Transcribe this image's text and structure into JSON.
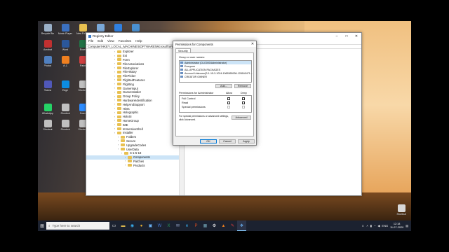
{
  "desktop": {
    "icons": [
      {
        "label": "Recycle Bin",
        "color": "#9ab0c8"
      },
      {
        "label": "Music Player",
        "color": "#3b70c0"
      },
      {
        "label": "New Folder",
        "color": "#e8c050"
      },
      {
        "label": "Notepad",
        "color": "#7aa8d8"
      },
      {
        "label": "Files",
        "color": "#3080e0"
      },
      {
        "label": "This PC",
        "color": "#4a90d0"
      },
      {
        "label": "Acrobat",
        "color": "#c03030"
      },
      {
        "label": "Word",
        "color": "#2b579a"
      },
      {
        "label": "Excel",
        "color": "#217346"
      },
      {
        "label": "Steam",
        "color": "#1b2838"
      },
      {
        "label": "Chrome",
        "color": "#e8b030"
      },
      {
        "label": "Firefox",
        "color": "#e86020"
      },
      {
        "label": "Photos",
        "color": "#5080c0"
      },
      {
        "label": "VLC",
        "color": "#f08020"
      },
      {
        "label": "Paint",
        "color": "#d04040"
      },
      {
        "label": "Opera",
        "color": "#d02030"
      },
      {
        "label": "Spotify",
        "color": "#1db954"
      },
      {
        "label": "Skype",
        "color": "#00aff0"
      },
      {
        "label": "Teams",
        "color": "#5058b8"
      },
      {
        "label": "Edge",
        "color": "#0c8ce0"
      },
      {
        "label": "Shortcut",
        "color": "#c0c0c0"
      },
      {
        "label": "Shortcut",
        "color": "#c0c0c0"
      },
      {
        "label": "Shortcut",
        "color": "#c0c0c0"
      },
      {
        "label": "Shortcut",
        "color": "#c0c0c0"
      },
      {
        "label": "WhatsApp",
        "color": "#25d366"
      },
      {
        "label": "Shortcut",
        "color": "#c0c0c0"
      },
      {
        "label": "Zoom",
        "color": "#2d8cff"
      },
      {
        "label": "Shortcut",
        "color": "#c0c0c0"
      },
      {
        "label": "Shortcut",
        "color": "#c0c0c0"
      },
      {
        "label": "OBS Studio",
        "color": "#302e31"
      },
      {
        "label": "Shortcut",
        "color": "#c0c0c0"
      },
      {
        "label": "Shortcut",
        "color": "#c0c0c0"
      },
      {
        "label": "Shortcut",
        "color": "#c0c0c0"
      },
      {
        "label": "Shortcut",
        "color": "#c0c0c0"
      },
      {
        "label": "Shortcut",
        "color": "#c0c0c0"
      },
      {
        "label": "Shortcut",
        "color": "#c0c0c0"
      }
    ],
    "right_icon": {
      "label": "Shortcut"
    }
  },
  "regedit": {
    "title": "Registry Editor",
    "menu": [
      "File",
      "Edit",
      "View",
      "Favorites",
      "Help"
    ],
    "address": "Computer\\HKEY_LOCAL_MACHINE\\SOFTWARE\\Microsoft\\Windows",
    "tree": [
      {
        "label": "Explorer",
        "indent": 0
      },
      {
        "label": "Ext",
        "indent": 0
      },
      {
        "label": "Form",
        "indent": 0
      },
      {
        "label": "FileAssociations",
        "indent": 0
      },
      {
        "label": "FileExplorer",
        "indent": 0
      },
      {
        "label": "FileHistory",
        "indent": 0
      },
      {
        "label": "FilePicker",
        "indent": 0
      },
      {
        "label": "FlightedFeatures",
        "indent": 0
      },
      {
        "label": "Flighting",
        "indent": 0
      },
      {
        "label": "Gamerinput",
        "indent": 0
      },
      {
        "label": "GameInstaller",
        "indent": 0
      },
      {
        "label": "Group Policy",
        "indent": 0
      },
      {
        "label": "HardwareIdentification",
        "indent": 0
      },
      {
        "label": "HelpAndSupport",
        "indent": 0
      },
      {
        "label": "Hints",
        "indent": 0
      },
      {
        "label": "Holographic",
        "indent": 0
      },
      {
        "label": "HoloSI",
        "indent": 0
      },
      {
        "label": "HomeGroup",
        "indent": 0
      },
      {
        "label": "IME",
        "indent": 0
      },
      {
        "label": "ImmersiveShell",
        "indent": 0
      },
      {
        "label": "Installer",
        "indent": 0
      },
      {
        "label": "Folders",
        "indent": 1
      },
      {
        "label": "Secure",
        "indent": 1
      },
      {
        "label": "UpgradeCodes",
        "indent": 1
      },
      {
        "label": "UserData",
        "indent": 1
      },
      {
        "label": "S-1-5-18",
        "indent": 2
      },
      {
        "label": "Components",
        "indent": 3,
        "selected": true
      },
      {
        "label": "Patches",
        "indent": 3
      },
      {
        "label": "Products",
        "indent": 3
      }
    ]
  },
  "permissions": {
    "title": "Permissions for Components",
    "tab": "Security",
    "group_label": "Group or user names:",
    "users": [
      "Administrator (DLO000\\Administrator)",
      "Everyone",
      "ALL APPLICATION PACKAGES",
      "Account Unknown(S-1-15-3-1024-1065365936-128160471...",
      "CREATOR OWNER"
    ],
    "add_label": "Add...",
    "remove_label": "Remove",
    "perm_header": "Permissions for Administrator",
    "allow_label": "Allow",
    "deny_label": "Deny",
    "perms": [
      "Full Control",
      "Read",
      "Special permissions"
    ],
    "special_note": "For special permissions or advanced settings, click Advanced.",
    "advanced_label": "Advanced",
    "ok_label": "OK",
    "cancel_label": "Cancel",
    "apply_label": "Apply"
  },
  "taskbar": {
    "search_placeholder": "Type here to search",
    "clock_time": "12:18",
    "clock_date": "11-07-2020",
    "language": "ENG"
  }
}
